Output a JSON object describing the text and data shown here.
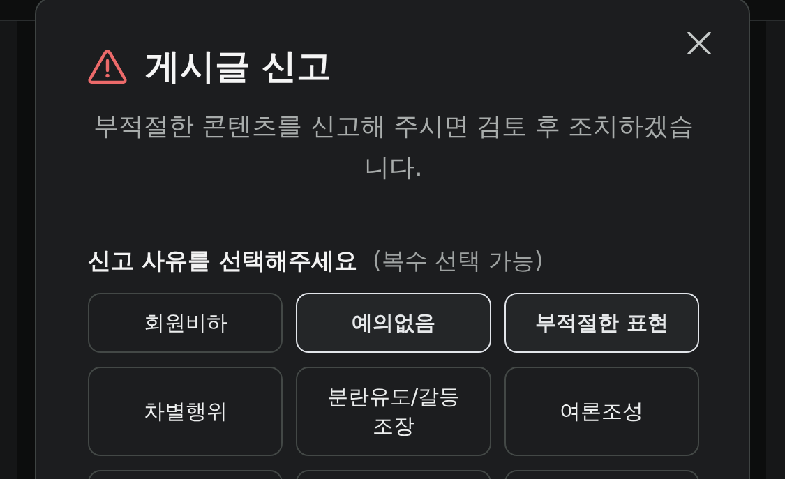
{
  "dialog": {
    "title": "게시글 신고",
    "description": "부적절한 콘텐츠를 신고해 주시면 검토 후 조치하겠습니다.",
    "reason_prompt": {
      "label": "신고 사유를 선택해주세요",
      "hint": "(복수 선택 가능)"
    },
    "reasons": [
      {
        "label": "회원비하",
        "selected": false
      },
      {
        "label": "예의없음",
        "selected": true
      },
      {
        "label": "부적절한 표현",
        "selected": true
      },
      {
        "label": "차별행위",
        "selected": false
      },
      {
        "label": "분란유도/갈등 조장",
        "selected": false
      },
      {
        "label": "여론조성",
        "selected": false
      },
      {
        "selected": false
      },
      {
        "selected": false
      },
      {
        "selected": false
      }
    ]
  }
}
